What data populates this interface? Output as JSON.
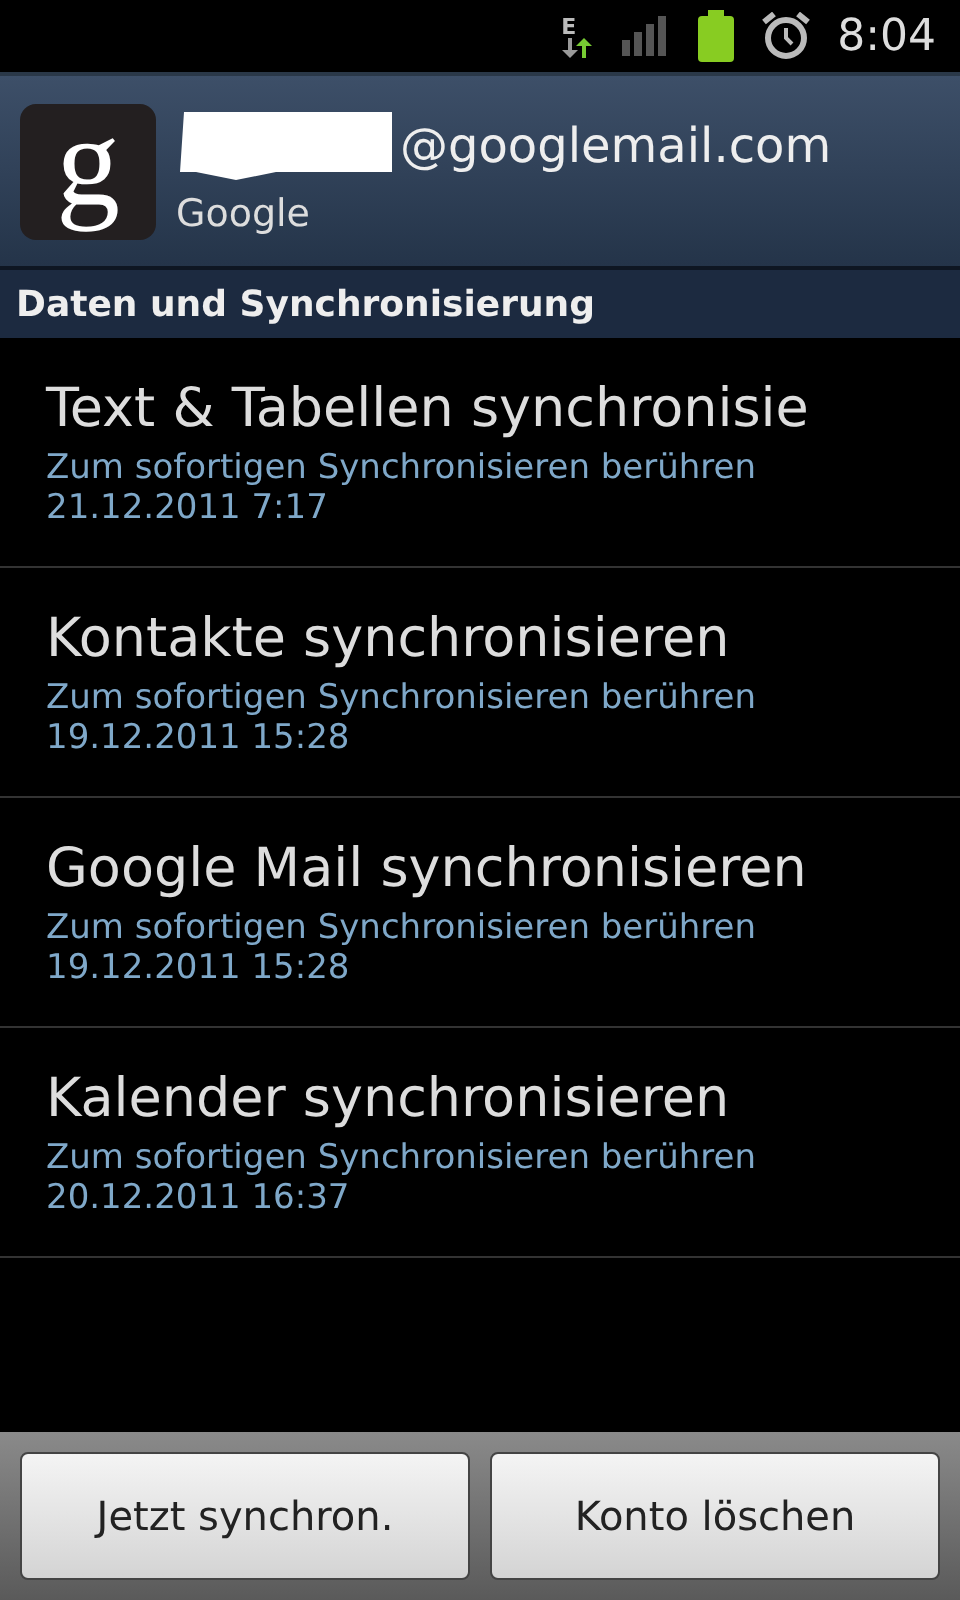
{
  "status_bar": {
    "network_type": "E",
    "time": "8:04"
  },
  "account": {
    "logo_letter": "g",
    "email": "@googlemail.com",
    "provider": "Google"
  },
  "section_title": "Daten und Synchronisierung",
  "items": [
    {
      "title": "Text & Tabellen synchronisie",
      "hint": "Zum sofortigen Synchronisieren berühren",
      "date": "21.12.2011 7:17"
    },
    {
      "title": "Kontakte synchronisieren",
      "hint": "Zum sofortigen Synchronisieren berühren",
      "date": "19.12.2011 15:28"
    },
    {
      "title": "Google Mail synchronisieren",
      "hint": "Zum sofortigen Synchronisieren berühren",
      "date": "19.12.2011 15:28"
    },
    {
      "title": "Kalender synchronisieren",
      "hint": "Zum sofortigen Synchronisieren berühren",
      "date": "20.12.2011 16:37"
    }
  ],
  "buttons": [
    "Jetzt synchron.",
    "Konto löschen"
  ]
}
